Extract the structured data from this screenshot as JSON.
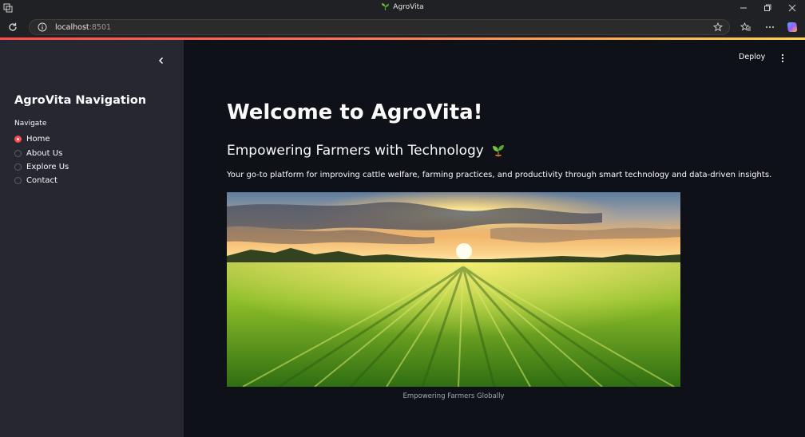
{
  "window": {
    "title": "AgroVita"
  },
  "addressbar": {
    "url_host": "localhost",
    "url_port": ":8501"
  },
  "toolbar": {
    "deploy_label": "Deploy"
  },
  "sidebar": {
    "title": "AgroVita Navigation",
    "radio_label": "Navigate",
    "items": [
      {
        "label": "Home",
        "selected": true
      },
      {
        "label": "About Us",
        "selected": false
      },
      {
        "label": "Explore Us",
        "selected": false
      },
      {
        "label": "Contact",
        "selected": false
      }
    ]
  },
  "main": {
    "title": "Welcome to AgroVita!",
    "subtitle": "Empowering Farmers with Technology",
    "description": "Your go-to platform for improving cattle welfare, farming practices, and productivity through smart technology and data-driven insights.",
    "image_caption": "Empowering Farmers Globally"
  },
  "colors": {
    "accent": "#ff4b4b",
    "sidebar_bg": "#262730",
    "main_bg": "#0e1117"
  },
  "icons": [
    "app-icon",
    "leaf-icon",
    "minimize-icon",
    "restore-icon",
    "close-icon",
    "reload-icon",
    "info-icon",
    "star-icon",
    "favorites-icon",
    "more-icon",
    "copilot-icon",
    "collapse-chevron-icon",
    "kebab-menu-icon",
    "sprout-icon"
  ]
}
